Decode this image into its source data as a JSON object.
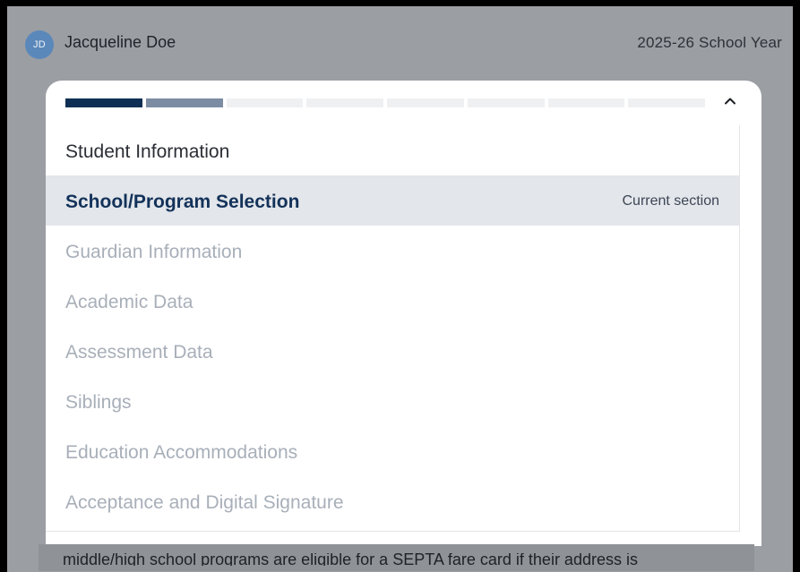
{
  "header": {
    "avatar_initials": "JD",
    "user_name": "Jacqueline Doe",
    "school_year": "2025-26 School Year"
  },
  "progress": {
    "total_steps": 8,
    "completed_steps": 1,
    "current_step": 2,
    "colors": {
      "done": "#0e2f53",
      "current": "#7c8da3",
      "pending": "#eff0f2"
    }
  },
  "sections": [
    {
      "label": "Student Information",
      "status": "completed"
    },
    {
      "label": "School/Program Selection",
      "status": "current",
      "tag": "Current section"
    },
    {
      "label": "Guardian Information",
      "status": "pending"
    },
    {
      "label": "Academic Data",
      "status": "pending"
    },
    {
      "label": "Assessment Data",
      "status": "pending"
    },
    {
      "label": "Siblings",
      "status": "pending"
    },
    {
      "label": "Education Accommodations",
      "status": "pending"
    },
    {
      "label": "Acceptance and Digital Signature",
      "status": "pending"
    }
  ],
  "icons": {
    "collapse": "chevron-up-icon"
  },
  "footer": {
    "partial_text": "middle/high school programs are eligible for a SEPTA fare card if their address is"
  }
}
